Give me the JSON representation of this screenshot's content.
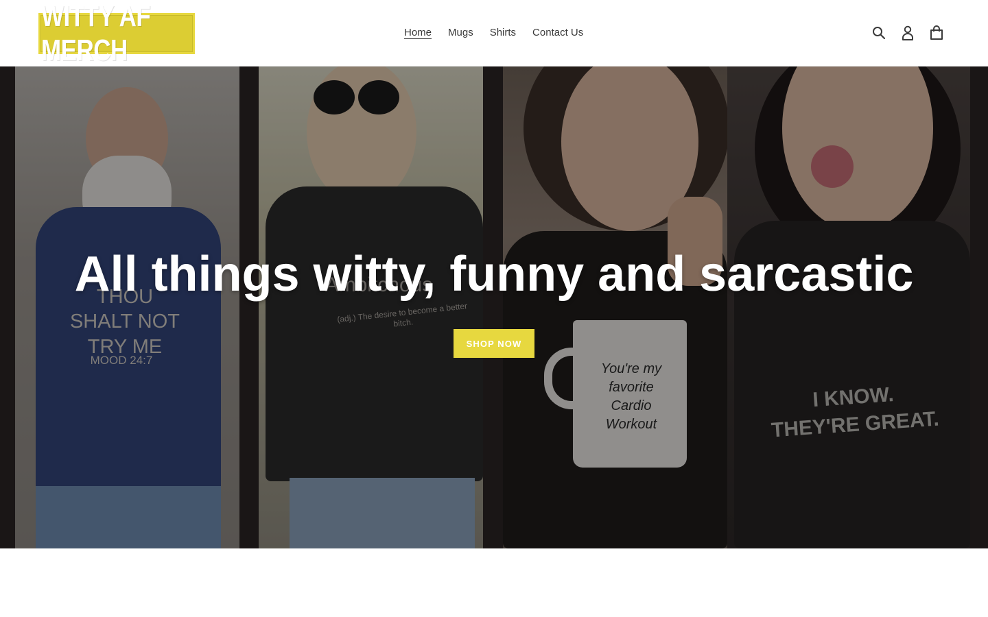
{
  "header": {
    "logo_text": "WITTY AF MERCH",
    "nav": [
      {
        "label": "Home",
        "active": true
      },
      {
        "label": "Mugs",
        "active": false
      },
      {
        "label": "Shirts",
        "active": false
      },
      {
        "label": "Contact Us",
        "active": false
      }
    ],
    "icons": [
      "search-icon",
      "account-icon",
      "cart-icon"
    ]
  },
  "hero": {
    "title": "All things witty, funny and sarcastic",
    "button_label": "SHOP NOW",
    "panels": [
      {
        "shirt_lines": [
          "THOU",
          "SHALT NOT",
          "TRY ME"
        ],
        "shirt_small": "MOOD 24:7"
      },
      {
        "shirt_lines": [
          "Ambitchous"
        ],
        "shirt_small": "(adj.) The desire to become a better bitch."
      },
      {
        "mug_lines": [
          "You're my",
          "favorite",
          "Cardio",
          "Workout"
        ]
      },
      {
        "shirt_lines": [
          "I KNOW.",
          "THEY'RE GREAT."
        ]
      }
    ]
  },
  "colors": {
    "accent": "#e7d83f",
    "text": "#3a3a3a",
    "hero_overlay": "rgba(0,0,0,0.38)"
  }
}
